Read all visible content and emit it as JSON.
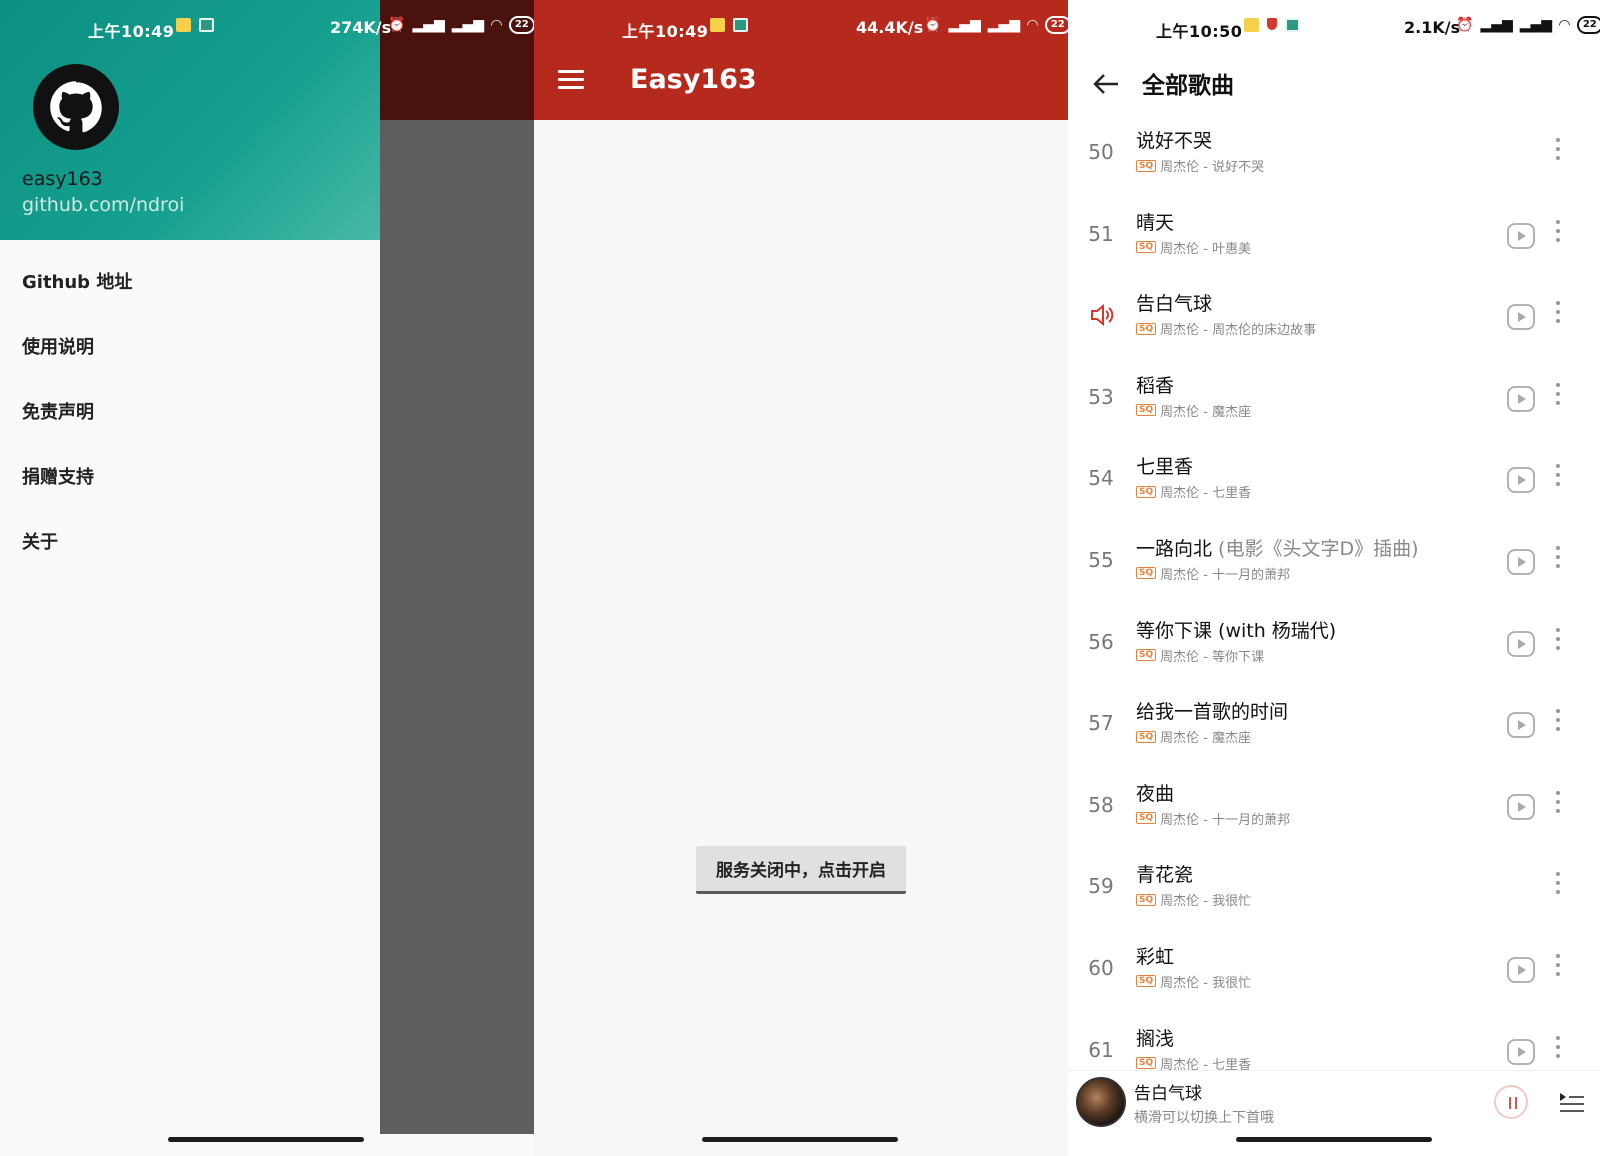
{
  "colors": {
    "teal": "#14998a",
    "red": "#b52a1d",
    "badge": "#e5823a"
  },
  "panel1": {
    "status": {
      "time": "上午10:49",
      "speed": "274K/s",
      "battery": "22"
    },
    "profile": {
      "name": "easy163",
      "link": "github.com/ndroi",
      "avatar_icon": "github-octocat-icon"
    },
    "menu": [
      {
        "label": "Github 地址"
      },
      {
        "label": "使用说明"
      },
      {
        "label": "免责声明"
      },
      {
        "label": "捐赠支持"
      },
      {
        "label": "关于"
      }
    ]
  },
  "panel2": {
    "status": {
      "time": "上午10:49",
      "speed": "44.4K/s",
      "battery": "22"
    },
    "title": "Easy163",
    "service_button": "服务关闭中，点击开启"
  },
  "panel3": {
    "status": {
      "time": "上午10:50",
      "speed": "2.1K/s",
      "battery": "22"
    },
    "title": "全部歌曲",
    "badge": "SQ",
    "songs": [
      {
        "num": "50",
        "title": "说好不哭",
        "extra": "",
        "artist": "周杰伦 - 说好不哭",
        "play": false,
        "playing": false
      },
      {
        "num": "51",
        "title": "晴天",
        "extra": "",
        "artist": "周杰伦 - 叶惠美",
        "play": true,
        "playing": false
      },
      {
        "num": "",
        "title": "告白气球",
        "extra": "",
        "artist": "周杰伦 - 周杰伦的床边故事",
        "play": true,
        "playing": true
      },
      {
        "num": "53",
        "title": "稻香",
        "extra": "",
        "artist": "周杰伦 - 魔杰座",
        "play": true,
        "playing": false
      },
      {
        "num": "54",
        "title": "七里香",
        "extra": "",
        "artist": "周杰伦 - 七里香",
        "play": true,
        "playing": false
      },
      {
        "num": "55",
        "title": "一路向北",
        "extra": " (电影《头文字D》插曲)",
        "artist": "周杰伦 - 十一月的萧邦",
        "play": true,
        "playing": false
      },
      {
        "num": "56",
        "title": "等你下课 (with 杨瑞代)",
        "extra": "",
        "artist": "周杰伦 - 等你下课",
        "play": true,
        "playing": false
      },
      {
        "num": "57",
        "title": "给我一首歌的时间",
        "extra": "",
        "artist": "周杰伦 - 魔杰座",
        "play": true,
        "playing": false
      },
      {
        "num": "58",
        "title": "夜曲",
        "extra": "",
        "artist": "周杰伦 - 十一月的萧邦",
        "play": true,
        "playing": false
      },
      {
        "num": "59",
        "title": "青花瓷",
        "extra": "",
        "artist": "周杰伦 - 我很忙",
        "play": false,
        "playing": false
      },
      {
        "num": "60",
        "title": "彩虹",
        "extra": "",
        "artist": "周杰伦 - 我很忙",
        "play": true,
        "playing": false
      },
      {
        "num": "61",
        "title": "搁浅",
        "extra": "",
        "artist": "周杰伦 - 七里香",
        "play": true,
        "playing": false
      }
    ],
    "player": {
      "title": "告白气球",
      "subtitle": "横滑可以切换上下首哦"
    }
  }
}
